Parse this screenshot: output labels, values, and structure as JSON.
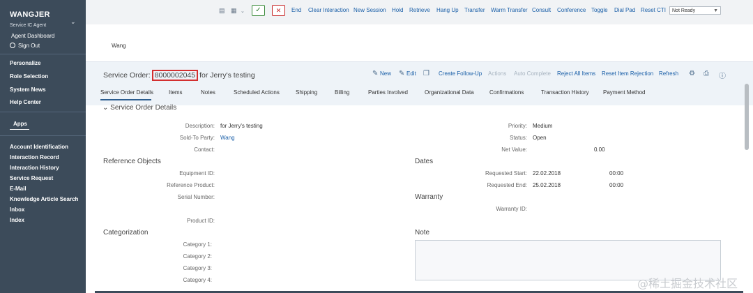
{
  "sidebar": {
    "user": "WANGJER",
    "role": "Service IC Agent",
    "dashboard": "Agent Dashboard",
    "signout": "Sign Out",
    "links": [
      "Personalize",
      "Role Selection",
      "System News",
      "Help Center"
    ],
    "apps_label": "Apps",
    "apps": [
      "Account Identification",
      "Interaction Record",
      "Interaction History",
      "Service Request",
      "E-Mail",
      "Knowledge Article Search",
      "Inbox",
      "Index"
    ]
  },
  "toolbar": {
    "check": "✓",
    "cross": "✕",
    "buttons": [
      "End",
      "Clear Interaction",
      "New Session",
      "Hold",
      "Retrieve",
      "Hang Up",
      "Transfer",
      "Warm Transfer",
      "Consult",
      "Conference",
      "Toggle",
      "Dial Pad",
      "Reset CTI"
    ],
    "status_select": "Not Ready"
  },
  "business_partner": "Wang",
  "header": {
    "title_prefix": "Service Order:",
    "order_id": "8000002045",
    "title_suffix": "for Jerry's testing",
    "actions": {
      "new": "New",
      "edit": "Edit",
      "create_followup": "Create Follow-Up",
      "actions": "Actions",
      "auto_complete": "Auto Complete",
      "reject_all": "Reject All Items",
      "reset_rejection": "Reset Item Rejection",
      "refresh": "Refresh"
    }
  },
  "tabs": [
    "Service Order Details",
    "Items",
    "Notes",
    "Scheduled Actions",
    "Shipping",
    "Billing",
    "Parties Involved",
    "Organizational Data",
    "Confirmations",
    "Transaction History",
    "Payment Method"
  ],
  "details": {
    "section": "Service Order Details",
    "description_label": "Description:",
    "description": "for Jerry's testing",
    "sold_to_label": "Sold-To Party:",
    "sold_to": "Wang",
    "contact_label": "Contact:",
    "priority_label": "Priority:",
    "priority": "Medium",
    "status_label": "Status:",
    "status": "Open",
    "net_value_label": "Net Value:",
    "net_value": "0.00"
  },
  "reference": {
    "section": "Reference Objects",
    "labels": [
      "Equipment ID:",
      "Reference Product:",
      "Serial Number:",
      "Product ID:"
    ]
  },
  "dates": {
    "section": "Dates",
    "start_label": "Requested Start:",
    "start_date": "22.02.2018",
    "start_time": "00:00",
    "end_label": "Requested End:",
    "end_date": "25.02.2018",
    "end_time": "00:00"
  },
  "warranty": {
    "section": "Warranty",
    "id_label": "Warranty ID:"
  },
  "categorization": {
    "section": "Categorization",
    "labels": [
      "Category 1:",
      "Category 2:",
      "Category 3:",
      "Category 4:"
    ]
  },
  "note": {
    "section": "Note"
  },
  "watermark": "@稀土掘金技术社区"
}
